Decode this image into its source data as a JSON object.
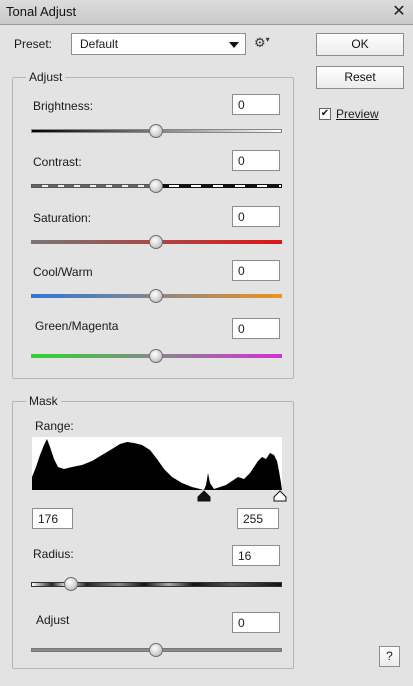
{
  "window": {
    "title": "Tonal Adjust"
  },
  "preset": {
    "label": "Preset:",
    "value": "Default"
  },
  "buttons": {
    "ok": "OK",
    "reset": "Reset",
    "help": "?"
  },
  "preview": {
    "label": "Preview",
    "checked": true
  },
  "adjust_group": {
    "title": "Adjust",
    "sliders": [
      {
        "label": "Brightness:",
        "value": "0",
        "level": 0.5
      },
      {
        "label": "Contrast:",
        "value": "0",
        "level": 0.5
      },
      {
        "label": "Saturation:",
        "value": "0",
        "level": 0.5
      },
      {
        "label": "Cool/Warm",
        "value": "0",
        "level": 0.5
      },
      {
        "label": "Green/Magenta",
        "value": "0",
        "level": 0.5
      }
    ]
  },
  "mask_group": {
    "title": "Mask",
    "range_label": "Range:",
    "range_low": "176",
    "range_high": "255",
    "radius": {
      "label": "Radius:",
      "value": "16",
      "level": 0.16
    },
    "adjust": {
      "label": "Adjust",
      "value": "0",
      "level": 0.5
    }
  },
  "colors": {
    "brightness": [
      "#000000",
      "#ffffff"
    ],
    "saturation": [
      "#777777",
      "#e01515"
    ],
    "cool_warm": [
      "#2e77d8",
      "#f0921c"
    ],
    "green_magenta": [
      "#2fd52f",
      "#d52fd5"
    ]
  }
}
